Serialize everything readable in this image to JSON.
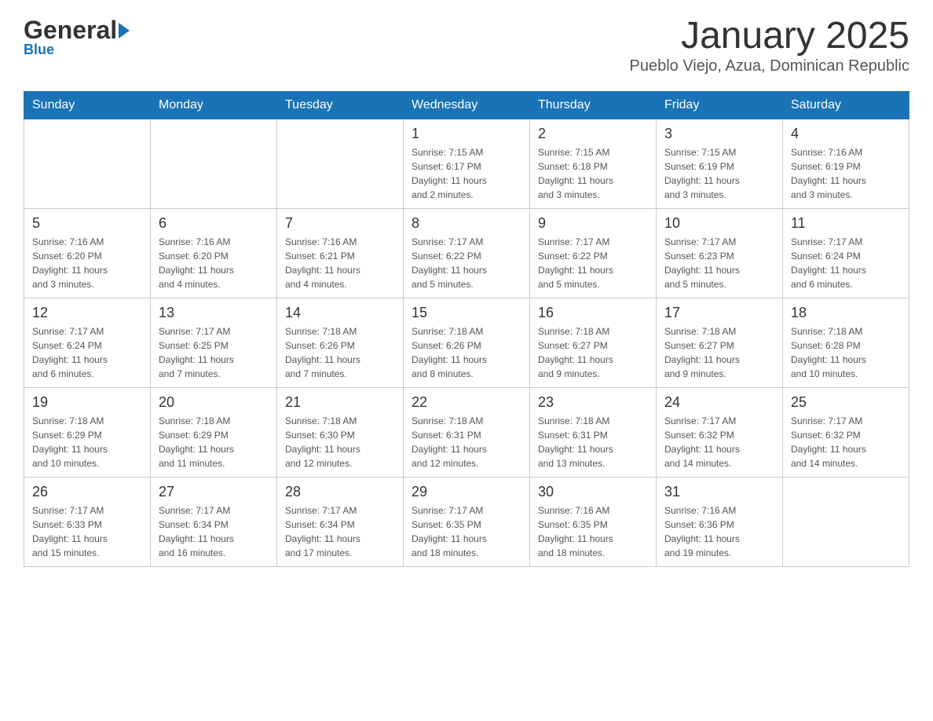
{
  "header": {
    "logo_general": "General",
    "logo_blue": "Blue",
    "title": "January 2025",
    "subtitle": "Pueblo Viejo, Azua, Dominican Republic"
  },
  "days_of_week": [
    "Sunday",
    "Monday",
    "Tuesday",
    "Wednesday",
    "Thursday",
    "Friday",
    "Saturday"
  ],
  "weeks": [
    [
      {
        "day": "",
        "info": ""
      },
      {
        "day": "",
        "info": ""
      },
      {
        "day": "",
        "info": ""
      },
      {
        "day": "1",
        "info": "Sunrise: 7:15 AM\nSunset: 6:17 PM\nDaylight: 11 hours\nand 2 minutes."
      },
      {
        "day": "2",
        "info": "Sunrise: 7:15 AM\nSunset: 6:18 PM\nDaylight: 11 hours\nand 3 minutes."
      },
      {
        "day": "3",
        "info": "Sunrise: 7:15 AM\nSunset: 6:19 PM\nDaylight: 11 hours\nand 3 minutes."
      },
      {
        "day": "4",
        "info": "Sunrise: 7:16 AM\nSunset: 6:19 PM\nDaylight: 11 hours\nand 3 minutes."
      }
    ],
    [
      {
        "day": "5",
        "info": "Sunrise: 7:16 AM\nSunset: 6:20 PM\nDaylight: 11 hours\nand 3 minutes."
      },
      {
        "day": "6",
        "info": "Sunrise: 7:16 AM\nSunset: 6:20 PM\nDaylight: 11 hours\nand 4 minutes."
      },
      {
        "day": "7",
        "info": "Sunrise: 7:16 AM\nSunset: 6:21 PM\nDaylight: 11 hours\nand 4 minutes."
      },
      {
        "day": "8",
        "info": "Sunrise: 7:17 AM\nSunset: 6:22 PM\nDaylight: 11 hours\nand 5 minutes."
      },
      {
        "day": "9",
        "info": "Sunrise: 7:17 AM\nSunset: 6:22 PM\nDaylight: 11 hours\nand 5 minutes."
      },
      {
        "day": "10",
        "info": "Sunrise: 7:17 AM\nSunset: 6:23 PM\nDaylight: 11 hours\nand 5 minutes."
      },
      {
        "day": "11",
        "info": "Sunrise: 7:17 AM\nSunset: 6:24 PM\nDaylight: 11 hours\nand 6 minutes."
      }
    ],
    [
      {
        "day": "12",
        "info": "Sunrise: 7:17 AM\nSunset: 6:24 PM\nDaylight: 11 hours\nand 6 minutes."
      },
      {
        "day": "13",
        "info": "Sunrise: 7:17 AM\nSunset: 6:25 PM\nDaylight: 11 hours\nand 7 minutes."
      },
      {
        "day": "14",
        "info": "Sunrise: 7:18 AM\nSunset: 6:26 PM\nDaylight: 11 hours\nand 7 minutes."
      },
      {
        "day": "15",
        "info": "Sunrise: 7:18 AM\nSunset: 6:26 PM\nDaylight: 11 hours\nand 8 minutes."
      },
      {
        "day": "16",
        "info": "Sunrise: 7:18 AM\nSunset: 6:27 PM\nDaylight: 11 hours\nand 9 minutes."
      },
      {
        "day": "17",
        "info": "Sunrise: 7:18 AM\nSunset: 6:27 PM\nDaylight: 11 hours\nand 9 minutes."
      },
      {
        "day": "18",
        "info": "Sunrise: 7:18 AM\nSunset: 6:28 PM\nDaylight: 11 hours\nand 10 minutes."
      }
    ],
    [
      {
        "day": "19",
        "info": "Sunrise: 7:18 AM\nSunset: 6:29 PM\nDaylight: 11 hours\nand 10 minutes."
      },
      {
        "day": "20",
        "info": "Sunrise: 7:18 AM\nSunset: 6:29 PM\nDaylight: 11 hours\nand 11 minutes."
      },
      {
        "day": "21",
        "info": "Sunrise: 7:18 AM\nSunset: 6:30 PM\nDaylight: 11 hours\nand 12 minutes."
      },
      {
        "day": "22",
        "info": "Sunrise: 7:18 AM\nSunset: 6:31 PM\nDaylight: 11 hours\nand 12 minutes."
      },
      {
        "day": "23",
        "info": "Sunrise: 7:18 AM\nSunset: 6:31 PM\nDaylight: 11 hours\nand 13 minutes."
      },
      {
        "day": "24",
        "info": "Sunrise: 7:17 AM\nSunset: 6:32 PM\nDaylight: 11 hours\nand 14 minutes."
      },
      {
        "day": "25",
        "info": "Sunrise: 7:17 AM\nSunset: 6:32 PM\nDaylight: 11 hours\nand 14 minutes."
      }
    ],
    [
      {
        "day": "26",
        "info": "Sunrise: 7:17 AM\nSunset: 6:33 PM\nDaylight: 11 hours\nand 15 minutes."
      },
      {
        "day": "27",
        "info": "Sunrise: 7:17 AM\nSunset: 6:34 PM\nDaylight: 11 hours\nand 16 minutes."
      },
      {
        "day": "28",
        "info": "Sunrise: 7:17 AM\nSunset: 6:34 PM\nDaylight: 11 hours\nand 17 minutes."
      },
      {
        "day": "29",
        "info": "Sunrise: 7:17 AM\nSunset: 6:35 PM\nDaylight: 11 hours\nand 18 minutes."
      },
      {
        "day": "30",
        "info": "Sunrise: 7:16 AM\nSunset: 6:35 PM\nDaylight: 11 hours\nand 18 minutes."
      },
      {
        "day": "31",
        "info": "Sunrise: 7:16 AM\nSunset: 6:36 PM\nDaylight: 11 hours\nand 19 minutes."
      },
      {
        "day": "",
        "info": ""
      }
    ]
  ],
  "colors": {
    "header_bg": "#1a73b5",
    "header_text": "#ffffff",
    "border": "#cccccc",
    "day_number": "#333333",
    "day_info": "#555555"
  }
}
